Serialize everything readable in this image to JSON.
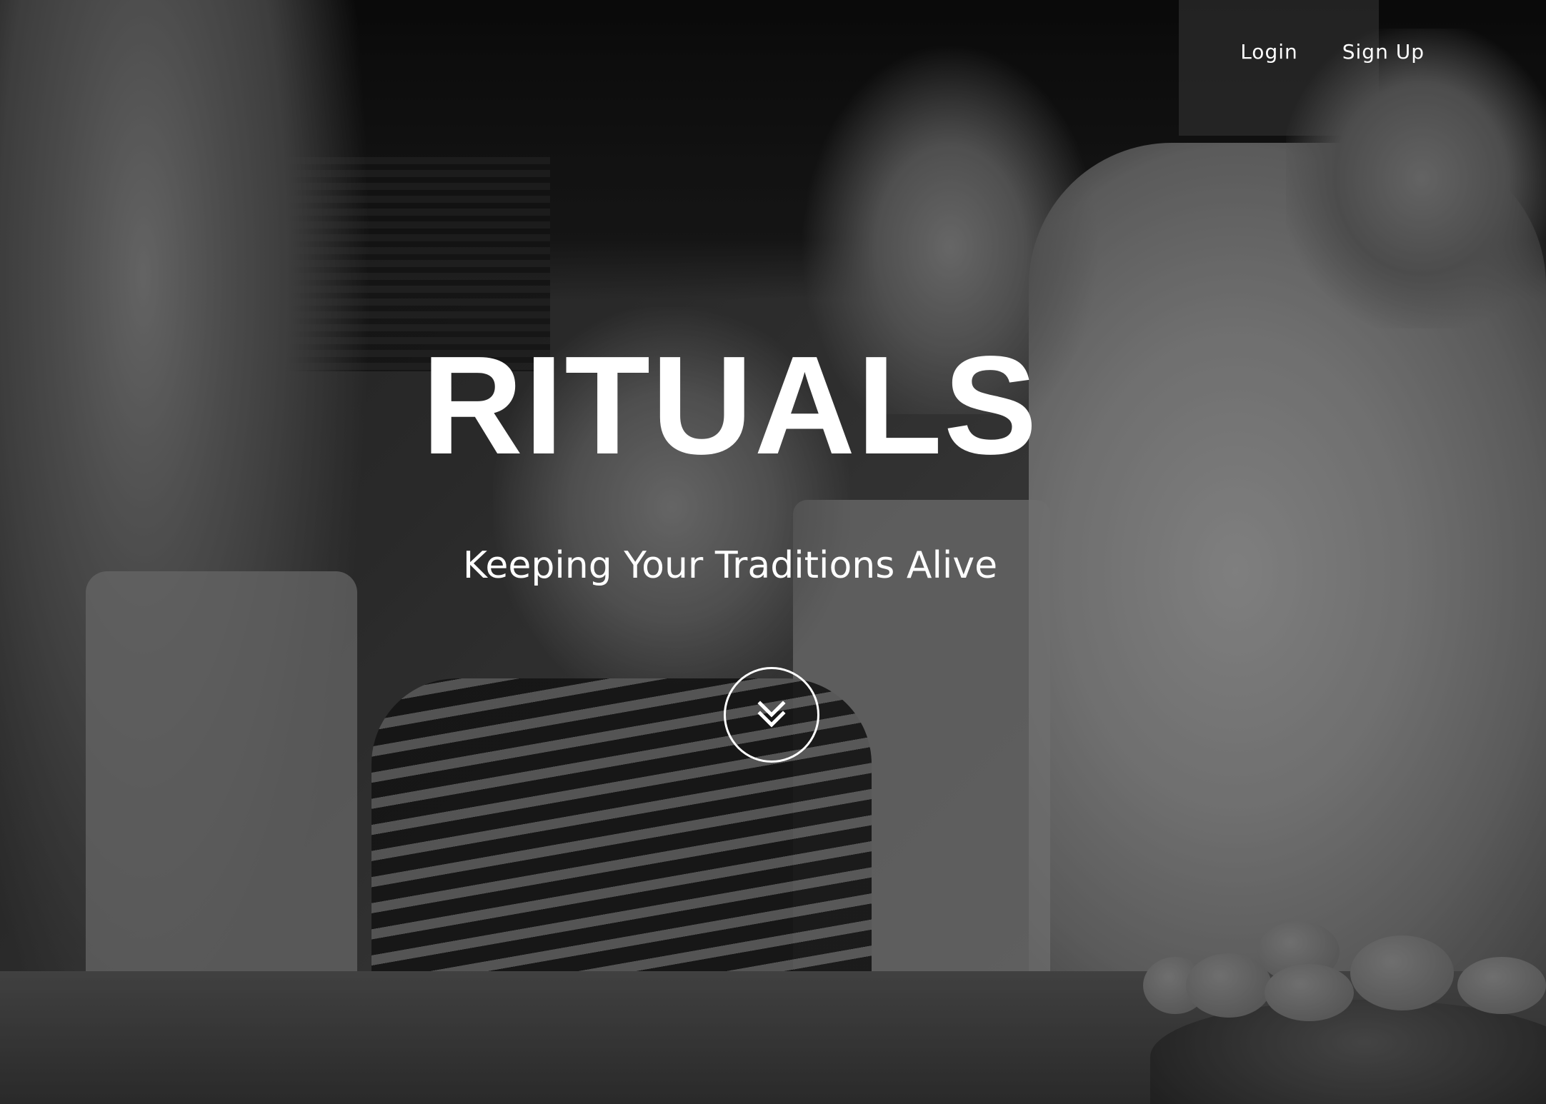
{
  "nav": {
    "login_label": "Login",
    "signup_label": "Sign Up"
  },
  "hero": {
    "title": "RITUALS",
    "subtitle": "Keeping Your Traditions Alive",
    "scroll_icon": "double-chevron-down-icon"
  },
  "colors": {
    "text": "#ffffff",
    "overlay": "rgba(0,0,0,0.28)"
  }
}
